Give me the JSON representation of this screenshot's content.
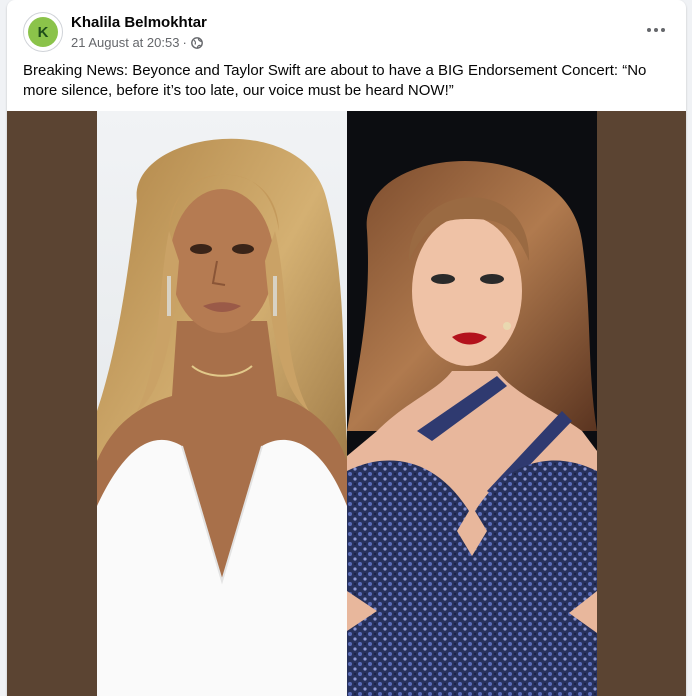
{
  "post": {
    "author": "Khalila Belmokhtar",
    "avatar_initial": "K",
    "timestamp": "21 August at 20:53",
    "separator": "·",
    "privacy_icon": "globe-icon",
    "more_icon": "more-options-icon",
    "text": "Breaking News: Beyonce and Taylor Swift are about to have a BIG Endorsement Concert: “No more silence, before it’s too late, our voice must be heard NOW!”"
  },
  "media": {
    "frame_color": "#5b4432",
    "left_photo": "photo-beyonce",
    "right_photo": "photo-taylor-swift"
  },
  "colors": {
    "card_bg": "#ffffff",
    "page_bg": "#f0f2f5",
    "text_primary": "#050505",
    "text_secondary": "#65676b",
    "avatar_bg": "#8bc34a"
  }
}
